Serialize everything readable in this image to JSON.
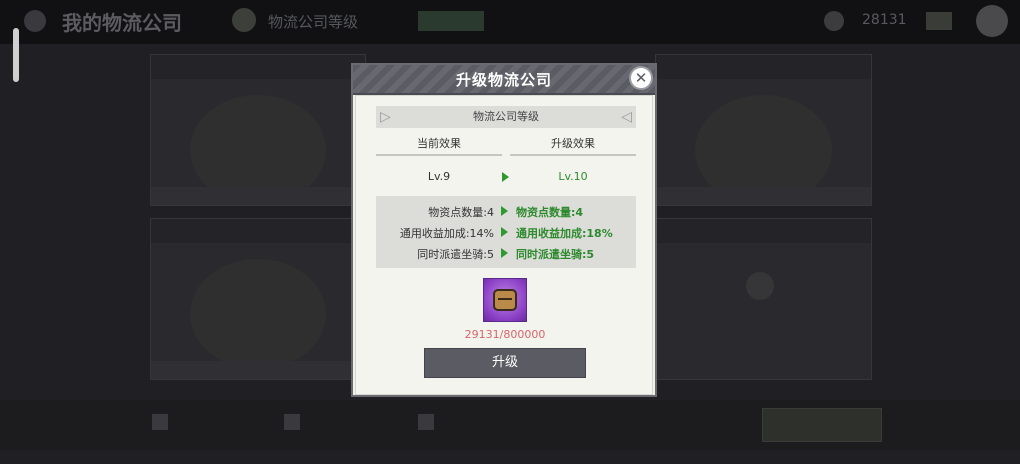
{
  "background": {
    "page_title": "我的物流公司",
    "level_label": "物流公司等级",
    "currency_amount": "28131"
  },
  "dialog": {
    "title": "升级物流公司",
    "close_label": "✕",
    "section_title": "物流公司等级",
    "current_header": "当前效果",
    "upgrade_header": "升级效果",
    "current_level": "Lv.9",
    "next_level": "Lv.10",
    "stats": [
      {
        "current": "物资点数量:4",
        "upgraded": "物资点数量:4"
      },
      {
        "current": "通用收益加成:14%",
        "upgraded": "通用收益加成:18%"
      },
      {
        "current": "同时派遣坐骑:5",
        "upgraded": "同时派遣坐骑:5"
      }
    ],
    "cost": "29131/800000",
    "upgrade_label": "升级"
  },
  "colors": {
    "accent_green": "#2e8a2e",
    "cost_red": "#d9646a",
    "header_gray": "#5a5b63",
    "item_purple": "#8a3fc4"
  },
  "icons": [
    "back-icon",
    "level-icon",
    "coin-icon",
    "avatar",
    "close-icon",
    "arrow-right-icon",
    "chest-icon",
    "lock-icon"
  ]
}
